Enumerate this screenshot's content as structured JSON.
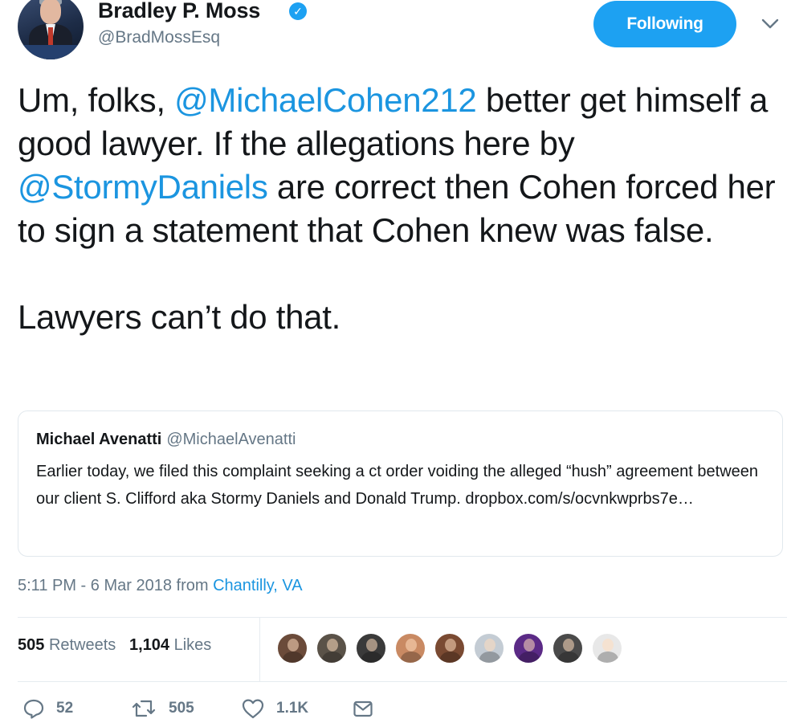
{
  "author": {
    "name": "Bradley P. Moss",
    "handle": "@BradMossEsq",
    "verified_icon": "verified-badge-icon"
  },
  "follow_button": {
    "label": "Following"
  },
  "tweet": {
    "segments": [
      {
        "text": "Um, folks, ",
        "mention": false
      },
      {
        "text": "@MichaelCohen212",
        "mention": true
      },
      {
        "text": " better get himself a good lawyer. If the allegations here by ",
        "mention": false
      },
      {
        "text": "@StormyDaniels",
        "mention": true
      },
      {
        "text": " are correct then Cohen forced her to sign a statement that Cohen knew was false.\n\nLawyers can’t do that.",
        "mention": false
      }
    ]
  },
  "quoted_tweet": {
    "name": "Michael Avenatti",
    "handle": "@MichaelAvenatti",
    "body": "Earlier today, we filed this complaint seeking a ct order voiding the alleged “hush” agreement between our client S. Clifford aka Stormy Daniels and Donald Trump. dropbox.com/s/ocvnkwprbs7e…"
  },
  "meta": {
    "time": "5:11 PM - 6 Mar 2018",
    "from_label": " from ",
    "location": "Chantilly, VA"
  },
  "stats": {
    "retweets_count": "505",
    "retweets_label": "Retweets",
    "likes_count": "1,104",
    "likes_label": "Likes"
  },
  "likers": [
    {
      "name": "liker-avatar-1",
      "color": "#6b4b3a"
    },
    {
      "name": "liker-avatar-2",
      "color": "#5a5248"
    },
    {
      "name": "liker-avatar-3",
      "color": "#3a3a3a"
    },
    {
      "name": "liker-avatar-4",
      "color": "#c98a63"
    },
    {
      "name": "liker-avatar-5",
      "color": "#7a4a32"
    },
    {
      "name": "liker-avatar-6",
      "color": "#c4ccd4"
    },
    {
      "name": "liker-avatar-7",
      "color": "#5b2a86"
    },
    {
      "name": "liker-avatar-8",
      "color": "#4a4a4a"
    },
    {
      "name": "liker-avatar-9",
      "color": "#e8e8e8"
    }
  ],
  "actions": {
    "reply_count": "52",
    "retweet_count": "505",
    "like_count": "1.1K"
  },
  "colors": {
    "accent": "#1da1f2",
    "link": "#1b95e0",
    "muted": "#657786"
  }
}
